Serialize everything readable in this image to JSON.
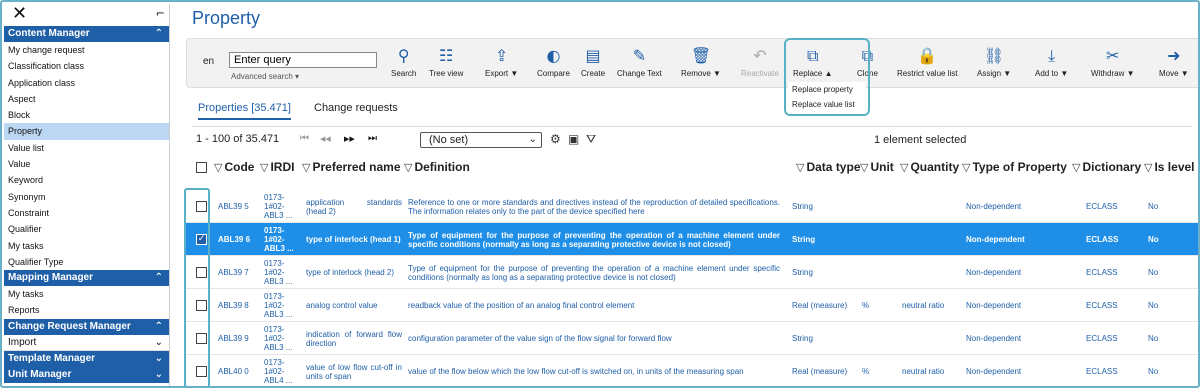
{
  "sidebar": {
    "close_glyph": "✕",
    "collapse_glyph": "⌐",
    "sections": [
      {
        "title": "Content Manager",
        "chevron": "⌃",
        "items": [
          "My change request",
          "Classification class",
          "Application class",
          "Aspect",
          "Block",
          "Property",
          "Value list",
          "Value",
          "Keyword",
          "Synonym",
          "Constraint",
          "Qualifier",
          "My tasks",
          "Qualifier Type"
        ]
      },
      {
        "title": "Mapping Manager",
        "chevron": "⌃",
        "items": [
          "My tasks",
          "Reports"
        ]
      },
      {
        "title": "Change Request Manager",
        "chevron": "⌃"
      },
      {
        "sub": "Import",
        "chevron": "⌄"
      },
      {
        "title": "Template Manager",
        "chevron": "⌄"
      },
      {
        "title": "Unit Manager",
        "chevron": "⌄"
      }
    ],
    "active_item": "Property"
  },
  "page_title": "Property",
  "toolbar": {
    "language": "en",
    "query_value": "Enter query",
    "advanced_search": "Advanced search ▾",
    "buttons": [
      {
        "label": "Search",
        "icon": "search-icon",
        "glyph": "⚲"
      },
      {
        "label": "Tree view",
        "icon": "tree-view-icon",
        "glyph": "☷"
      },
      {
        "label": "Export ▼",
        "icon": "export-icon",
        "glyph": "⇪"
      },
      {
        "label": "Compare",
        "icon": "compare-icon",
        "glyph": "◐"
      },
      {
        "label": "Create",
        "icon": "create-icon",
        "glyph": "▤"
      },
      {
        "label": "Change Text",
        "icon": "pencil-icon",
        "glyph": "✎"
      },
      {
        "label": "Remove ▼",
        "icon": "trash-icon",
        "glyph": "🗑"
      },
      {
        "label": "Reactivate",
        "icon": "reactivate-icon",
        "glyph": "↶"
      },
      {
        "label": "Replace ▲",
        "icon": "replace-icon",
        "glyph": "⧉"
      },
      {
        "label": "Clone",
        "icon": "clone-icon",
        "glyph": "⧉"
      },
      {
        "label": "Restrict value list",
        "icon": "restrict-icon",
        "glyph": "🔒"
      },
      {
        "label": "Assign ▼",
        "icon": "link-icon",
        "glyph": "⛓"
      },
      {
        "label": "Add to ▼",
        "icon": "add-to-icon",
        "glyph": "⤓"
      },
      {
        "label": "Withdraw ▼",
        "icon": "withdraw-icon",
        "glyph": "✂"
      },
      {
        "label": "Move ▼",
        "icon": "move-icon",
        "glyph": "➜"
      }
    ],
    "replace_menu": [
      "Replace property",
      "Replace value list"
    ]
  },
  "tabs": [
    "Properties [35.471]",
    "Change requests"
  ],
  "pager": {
    "range": "1 - 100 of 35.471",
    "first": "⏮",
    "prev": "◀◀",
    "next": "▶▶",
    "last": "⏭",
    "view_select": "(No set)",
    "selected_text": "1 element selected"
  },
  "columns": [
    "Code",
    "IRDI",
    "Preferred name",
    "Definition",
    "Data type",
    "Unit",
    "Quantity",
    "Type of Property",
    "Dictionary",
    "Is level"
  ],
  "rows": [
    {
      "code": "ABL39 5",
      "irdi": "0173-1#02-ABL3 ...",
      "name": "application standards (head 2)",
      "definition": "Reference to one or more standards and directives instead of the reproduction of detailed specifications. The information relates only to the part of the device specified here",
      "data_type": "String",
      "unit": "",
      "quantity": "",
      "type": "Non-dependent",
      "dictionary": "ECLASS",
      "is_level": "No",
      "checked": false
    },
    {
      "code": "ABL39 6",
      "irdi": "0173-1#02-ABL3 ...",
      "name": "type of interlock (head 1)",
      "definition": "Type of equipment for the purpose of preventing the operation of a machine element under specific conditions (normally as long as a separating protective device is not closed)",
      "data_type": "String",
      "unit": "",
      "quantity": "",
      "type": "Non-dependent",
      "dictionary": "ECLASS",
      "is_level": "No",
      "checked": true
    },
    {
      "code": "ABL39 7",
      "irdi": "0173-1#02-ABL3 ...",
      "name": "type of interlock (head 2)",
      "definition": "Type of equipment for the purpose of preventing the operation of a machine element under specific conditions (normally as long as a separating protective device is not closed)",
      "data_type": "String",
      "unit": "",
      "quantity": "",
      "type": "Non-dependent",
      "dictionary": "ECLASS",
      "is_level": "No",
      "checked": false
    },
    {
      "code": "ABL39 8",
      "irdi": "0173-1#02-ABL3 ...",
      "name": "analog control value",
      "definition": "readback value of the position of an analog final control element",
      "data_type": "Real (measure)",
      "unit": "%",
      "quantity": "neutral ratio",
      "type": "Non-dependent",
      "dictionary": "ECLASS",
      "is_level": "No",
      "checked": false
    },
    {
      "code": "ABL39 9",
      "irdi": "0173-1#02-ABL3 ...",
      "name": "indication of forward flow direction",
      "definition": "configuration parameter of the value sign of the flow signal for forward flow",
      "data_type": "String",
      "unit": "",
      "quantity": "",
      "type": "Non-dependent",
      "dictionary": "ECLASS",
      "is_level": "No",
      "checked": false
    },
    {
      "code": "ABL40 0",
      "irdi": "0173-1#02-ABL4 ...",
      "name": "value of low flow cut-off in units of span",
      "definition": "value of the flow below which the low flow cut-off is switched on, in units of the measuring span",
      "data_type": "Real (measure)",
      "unit": "%",
      "quantity": "neutral ratio",
      "type": "Non-dependent",
      "dictionary": "ECLASS",
      "is_level": "No",
      "checked": false
    }
  ],
  "colors": {
    "accent": "#1f5fa8",
    "selected_row": "#1e8ee6",
    "highlight_outline": "#5ab0c6",
    "active_sidebar": "#bcd7f2"
  }
}
